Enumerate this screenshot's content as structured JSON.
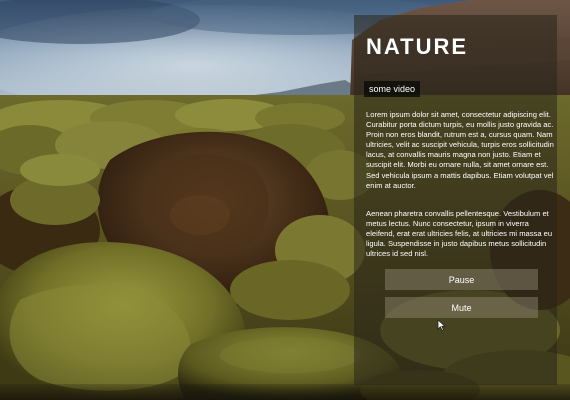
{
  "panel": {
    "title": "NATURE",
    "tag": "some video",
    "paragraphs": [
      "Lorem ipsum dolor sit amet, consectetur adipiscing elit. Curabitur porta dictum turpis, eu mollis justo gravida ac. Proin non eros blandit, rutrum est a, cursus quam. Nam ultricies, velit ac suscipit vehicula, turpis eros sollicitudin lacus, at convallis mauris magna non justo. Etiam et suscipit elit. Morbi eu ornare nulla, sit amet ornare est. Sed vehicula ipsum a mattis dapibus. Etiam volutpat vel enim at auctor.",
      "Aenean pharetra convallis pellentesque. Vestibulum et metus lectus. Nunc consectetur, ipsum in viverra eleifend, erat erat ultricies felis, at ultricies mi massa eu ligula. Suspendisse in justo dapibus metus sollicitudin ultrices id sed nisl."
    ],
    "buttons": {
      "pause": "Pause",
      "mute": "Mute"
    }
  },
  "colors": {
    "panel_background": "#28241a",
    "button_background": "#968c78",
    "tag_background": "#0a0c08",
    "text": "#ffffff"
  },
  "icons": {
    "cursor": "cursor-icon"
  }
}
